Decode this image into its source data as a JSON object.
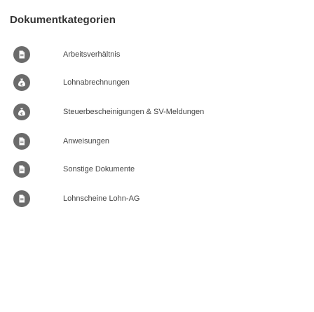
{
  "page": {
    "title": "Dokumentkategorien"
  },
  "categories": [
    {
      "label": "Arbeitsverhältnis",
      "icon": "document-icon"
    },
    {
      "label": "Lohnabrechnungen",
      "icon": "money-bag-icon"
    },
    {
      "label": "Steuerbescheinigungen & SV-Meldungen",
      "icon": "money-bag-icon"
    },
    {
      "label": "Anweisungen",
      "icon": "document-icon"
    },
    {
      "label": "Sonstige Dokumente",
      "icon": "document-icon"
    },
    {
      "label": "Lohnscheine Lohn-AG",
      "icon": "document-icon"
    }
  ],
  "colors": {
    "icon_bg": "#6b6b6b",
    "icon_fg": "#ffffff",
    "text": "#444444",
    "title": "#333333"
  }
}
